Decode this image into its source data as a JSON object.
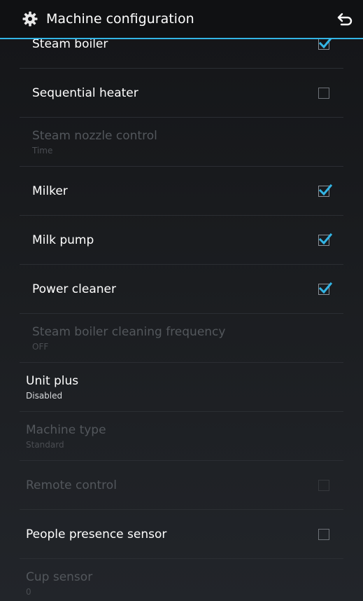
{
  "app": {
    "title": "Machine configuration"
  },
  "icons": {
    "app": "gear-icon",
    "back": "back-arrow-icon",
    "check": "checkmark-icon"
  },
  "colors": {
    "accent": "#33b5e5",
    "background": "#16171a",
    "text_primary": "#ffffff",
    "text_disabled": "#53575c"
  },
  "items": [
    {
      "title": "Steam boiler",
      "summary": "",
      "checkbox": "checked",
      "enabled": true
    },
    {
      "title": "Sequential heater",
      "summary": "",
      "checkbox": "unchecked",
      "enabled": true
    },
    {
      "title": "Steam nozzle control",
      "summary": "Time",
      "checkbox": "none",
      "enabled": false
    },
    {
      "title": "Milker",
      "summary": "",
      "checkbox": "checked",
      "enabled": true
    },
    {
      "title": "Milk pump",
      "summary": "",
      "checkbox": "checked",
      "enabled": true
    },
    {
      "title": "Power cleaner",
      "summary": "",
      "checkbox": "checked",
      "enabled": true
    },
    {
      "title": "Steam boiler cleaning frequency",
      "summary": "OFF",
      "checkbox": "none",
      "enabled": false
    },
    {
      "title": "Unit plus",
      "summary": "Disabled",
      "checkbox": "none",
      "enabled": true
    },
    {
      "title": "Machine type",
      "summary": "Standard",
      "checkbox": "none",
      "enabled": false
    },
    {
      "title": "Remote control",
      "summary": "",
      "checkbox": "unchecked",
      "enabled": false
    },
    {
      "title": "People presence sensor",
      "summary": "",
      "checkbox": "unchecked",
      "enabled": true
    },
    {
      "title": "Cup sensor",
      "summary": "0",
      "checkbox": "none",
      "enabled": false
    }
  ]
}
